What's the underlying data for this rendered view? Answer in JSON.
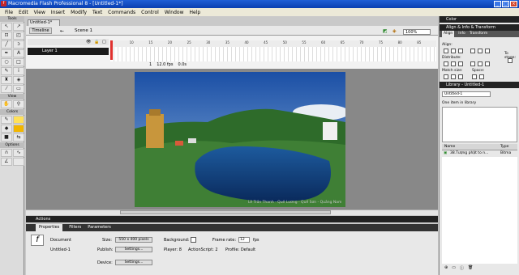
{
  "app": {
    "title": "Macromedia Flash Professional 8 - [Untitled-1*]"
  },
  "menu": [
    "File",
    "Edit",
    "View",
    "Insert",
    "Modify",
    "Text",
    "Commands",
    "Control",
    "Window",
    "Help"
  ],
  "tools": {
    "tools_header": "Tools",
    "view_header": "View",
    "colors_header": "Colors",
    "options_header": "Options"
  },
  "document": {
    "tab": "Untitled-1*",
    "timeline_button": "Timeline",
    "scene": "Scene 1",
    "zoom": "100%"
  },
  "timeline": {
    "layer": "Layer 1",
    "ruler": [
      "5",
      "10",
      "15",
      "20",
      "25",
      "30",
      "35",
      "40",
      "45",
      "50",
      "55",
      "60",
      "65",
      "70",
      "75",
      "80",
      "85"
    ],
    "frame": "1",
    "fps": "12.0 fps",
    "time": "0.0s"
  },
  "stage": {
    "caption": "Lê Trần Thanh - Quế Lương - Quế Sơn - Quảng Nam",
    "accent": "#1a4a9c"
  },
  "panels": {
    "actions": "Actions",
    "tabs": [
      "Properties",
      "Filters",
      "Parameters"
    ]
  },
  "properties": {
    "doc_label": "Document",
    "doc_name": "Untitled-1",
    "size_label": "Size:",
    "size_value": "550 x 400 pixels",
    "background_label": "Background:",
    "framerate_label": "Frame rate:",
    "framerate_value": "12",
    "fps_unit": "fps",
    "publish_label": "Publish:",
    "settings": "Settings...",
    "player_label": "Player: 8",
    "actionscript_label": "ActionScript: 2",
    "profile_label": "Profile: Default",
    "device_label": "Device:",
    "device_settings": "Settings..."
  },
  "right": {
    "color_header": "Color",
    "align_header": "Align & Info & Transform",
    "align_tabs": [
      "Align",
      "Info",
      "Transform"
    ],
    "align_label": "Align:",
    "distribute_label": "Distribute:",
    "match_label": "Match size:",
    "space_label": "Space:",
    "to_stage": "To stage:",
    "library_header": "Library - Untitled-1",
    "library_select": "Untitled-1",
    "library_count": "One item in library",
    "name_col": "Name",
    "type_col": "Type",
    "item_name": "38.Tượng phật to n...",
    "item_type": "Bitma"
  }
}
